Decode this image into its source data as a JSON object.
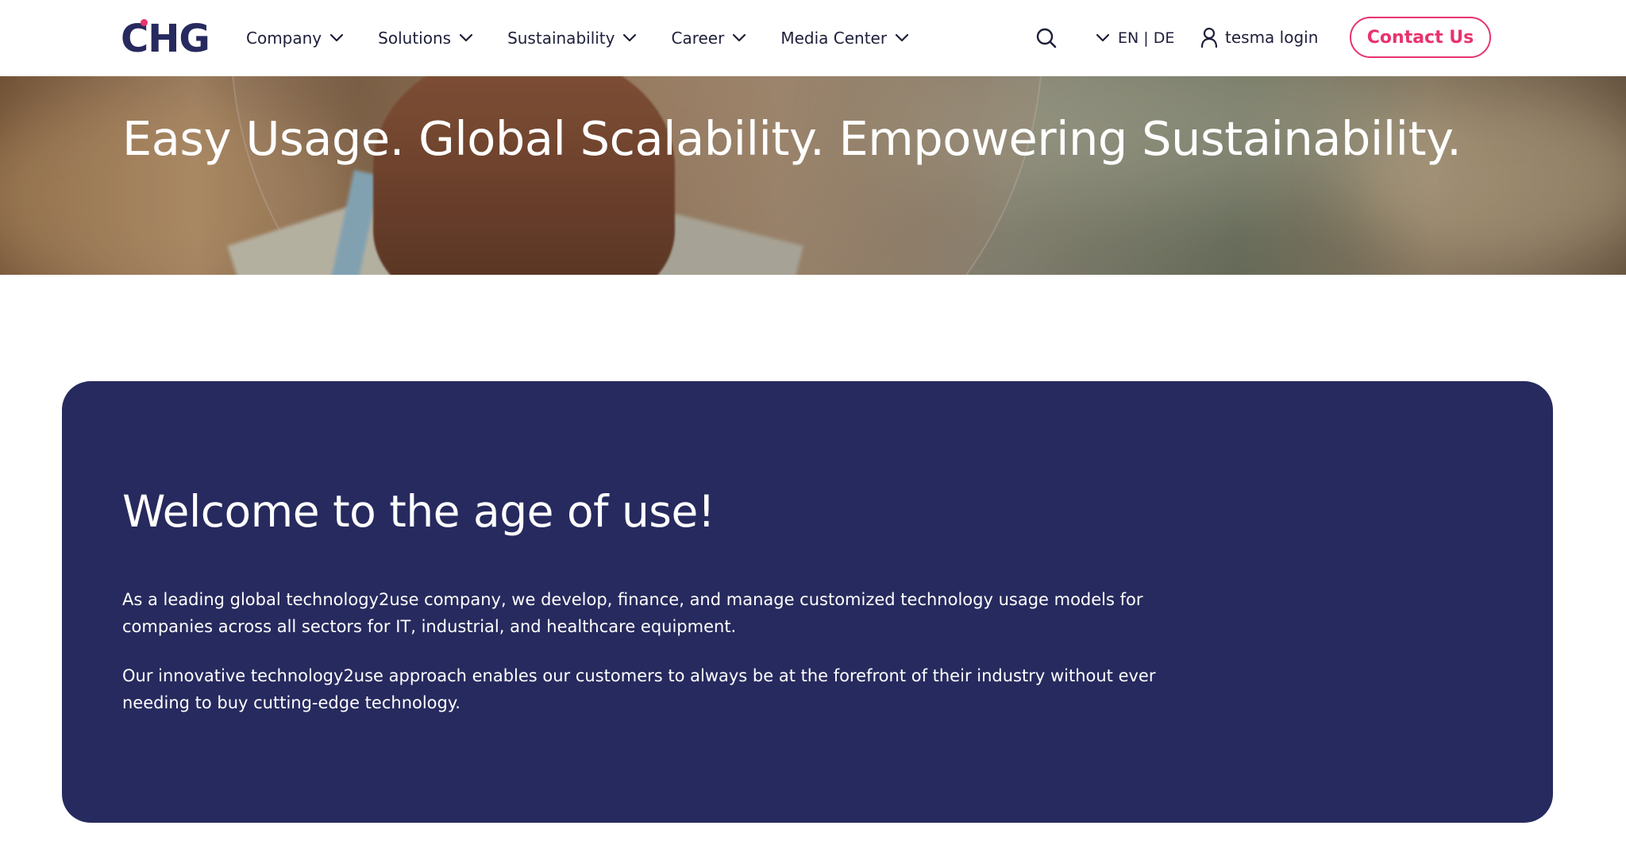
{
  "header": {
    "logo_text": "CHG",
    "nav": [
      {
        "label": "Company"
      },
      {
        "label": "Solutions"
      },
      {
        "label": "Sustainability"
      },
      {
        "label": "Career"
      },
      {
        "label": "Media Center"
      }
    ],
    "language_label": "EN | DE",
    "login_label": "tesma login",
    "contact_label": "Contact Us"
  },
  "hero": {
    "title": "Easy Usage. Global Scalability. Empowering Sustainability."
  },
  "intro": {
    "heading": "Welcome to the age of use!",
    "paragraphs": [
      "As a leading global technology2use company, we develop, finance, and manage customized technology usage models for companies across all sectors for IT, industrial, and healthcare equipment.",
      "Our innovative technology2use approach enables our customers to always be at the forefront of their industry without ever needing to buy cutting-edge technology."
    ]
  },
  "colors": {
    "brand_navy": "#272a5e",
    "accent_pink": "#e8336e",
    "white": "#ffffff"
  },
  "icons": [
    "chevron-down-icon",
    "search-icon",
    "user-icon"
  ]
}
